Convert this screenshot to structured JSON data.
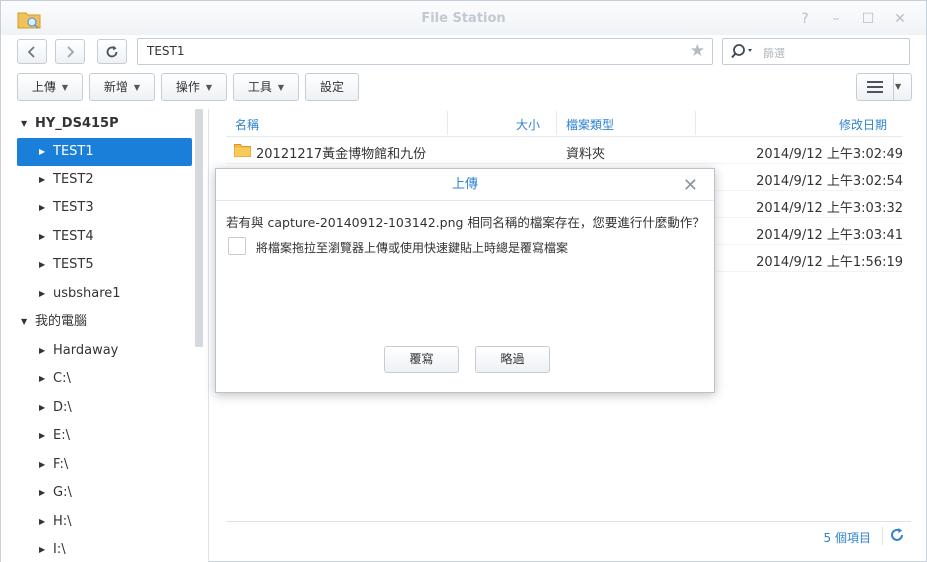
{
  "window": {
    "title": "File Station",
    "controls": [
      "?",
      "–",
      "☐",
      "✕"
    ]
  },
  "toolbar": {
    "path": "TEST1",
    "search_placeholder": "篩選",
    "buttons": [
      {
        "label": "上傳",
        "has_dropdown": true
      },
      {
        "label": "新增",
        "has_dropdown": true
      },
      {
        "label": "操作",
        "has_dropdown": true
      },
      {
        "label": "工具",
        "has_dropdown": true
      },
      {
        "label": "設定",
        "has_dropdown": false
      }
    ]
  },
  "sidebar": {
    "root": "HY_DS415P",
    "shares": [
      "TEST1",
      "TEST2",
      "TEST3",
      "TEST4",
      "TEST5",
      "usbshare1"
    ],
    "selected": "TEST1",
    "computer": "我的電腦",
    "drives": [
      "Hardaway",
      "C:\\",
      "D:\\",
      "E:\\",
      "F:\\",
      "G:\\",
      "H:\\",
      "I:\\"
    ]
  },
  "file_list": {
    "columns": [
      "名稱",
      "大小",
      "檔案類型",
      "修改日期"
    ],
    "rows": [
      {
        "name": "20121217黃金博物館和九份",
        "type": "資料夾",
        "date": "2014/9/12 上午3:02:49"
      },
      {
        "name": "",
        "type": "",
        "date": "2014/9/12 上午3:02:54"
      },
      {
        "name": "",
        "type": "",
        "date": "2014/9/12 上午3:03:32"
      },
      {
        "name": "",
        "type": "",
        "date": "2014/9/12 上午3:03:41"
      },
      {
        "name": "",
        "type": "",
        "date": "2014/9/12 上午1:56:19"
      }
    ],
    "item_count": "5 個項目"
  },
  "dialog": {
    "title": "上傳",
    "message": "若有與 capture-20140912-103142.png 相同名稱的檔案存在，您要進行什麼動作？",
    "checkbox_label": "將檔案拖拉至瀏覽器上傳或使用快速鍵貼上時總是覆寫檔案",
    "checkbox_checked": false,
    "overwrite_label": "覆寫",
    "skip_label": "略過"
  },
  "colors": {
    "accent": "#2f83d0",
    "selection": "#1a7fd8",
    "folder": "#f5b83a"
  }
}
